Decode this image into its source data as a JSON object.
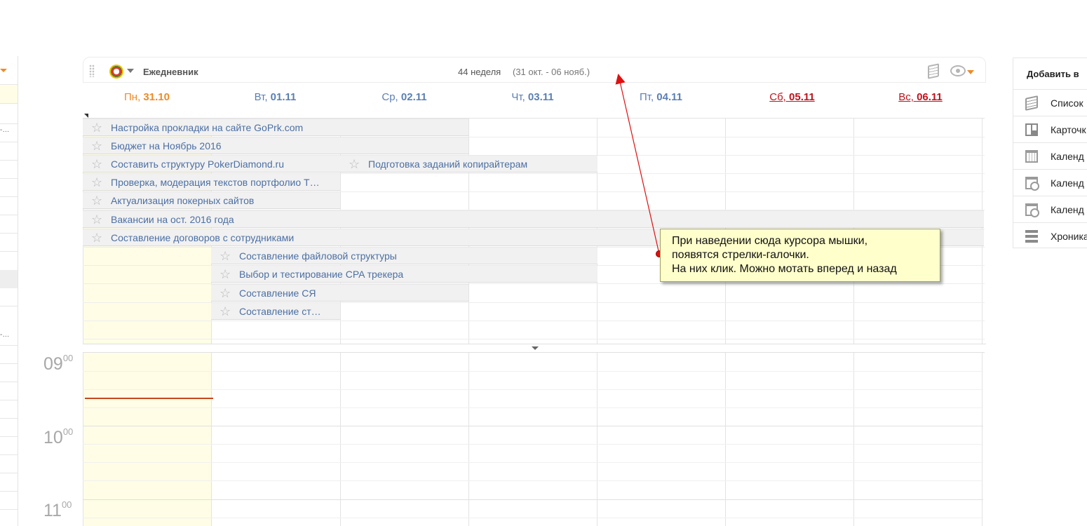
{
  "toolbar": {
    "title": "Ежедневник",
    "week_label": "44 неделя",
    "week_range": "(31 окт. - 06 нояб.)"
  },
  "days": [
    {
      "dow": "Пн,",
      "date": "31.10"
    },
    {
      "dow": "Вт,",
      "date": "01.11"
    },
    {
      "dow": "Ср,",
      "date": "02.11"
    },
    {
      "dow": "Чт,",
      "date": "03.11"
    },
    {
      "dow": "Пт,",
      "date": "04.11"
    },
    {
      "dow": "Сб,",
      "date": "05.11"
    },
    {
      "dow": "Вс,",
      "date": "06.11"
    }
  ],
  "tasks": [
    {
      "title": "Настройка прокладки на сайте GoPrk.com"
    },
    {
      "title": "Бюджет на Ноябрь 2016"
    },
    {
      "title": "Составить структуру PokerDiamond.ru"
    },
    {
      "title": "Подготовка заданий копирайтерам"
    },
    {
      "title": "Проверка, модерация текстов портфолио Т…"
    },
    {
      "title": "Актуализация покерных сайтов"
    },
    {
      "title": "Вакансии на ост. 2016 года"
    },
    {
      "title": "Составление договоров с сотрудниками"
    },
    {
      "title": "Составление файловой структуры"
    },
    {
      "title": "Выбор и тестирование CPA трекера"
    },
    {
      "title": "Составление СЯ"
    },
    {
      "title": "Составление ст…"
    }
  ],
  "hours": [
    {
      "h": "09",
      "m": "00"
    },
    {
      "h": "10",
      "m": "00"
    },
    {
      "h": "11",
      "m": "00"
    }
  ],
  "right_panel": {
    "title": "Добавить в",
    "items": [
      "Список",
      "Карточк",
      "Календ",
      "Календ",
      "Календ",
      "Хроника"
    ]
  },
  "left_panel": {
    "dots_1": "-…",
    "dots_2": "-…"
  },
  "annotation": {
    "line1": "При наведении сюда курсора мышки,",
    "line2": "появятся стрелки-галочки.",
    "line3": "На них клик. Можно мотать вперед и назад"
  },
  "colors": {
    "accent": "#f08a24",
    "link": "#5b7fb3",
    "weekend": "#c0131c",
    "today_bg": "#fffde6",
    "now_line": "#c6471d"
  }
}
